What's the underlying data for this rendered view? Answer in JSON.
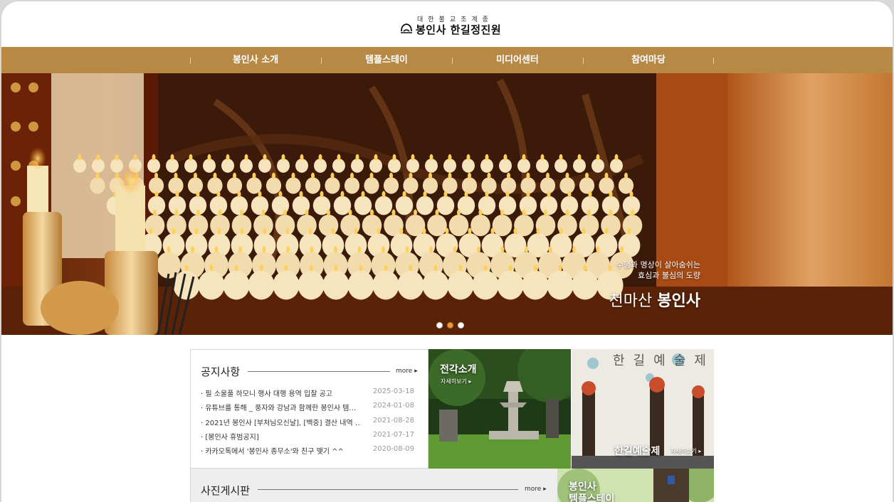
{
  "header": {
    "logo_subtitle": "대한불교조계종",
    "logo_name": "봉인사 한길정진원"
  },
  "nav": {
    "items": [
      "봉인사 소개",
      "템플스테이",
      "미디어센터",
      "참여마당"
    ]
  },
  "hero": {
    "line1": "수행과 명상이 살아숨쉬는",
    "line2": "효심과 불심의 도량",
    "title_prefix": "천마산 ",
    "title_bold": "봉인사",
    "slide_count": 3,
    "active_slide": 2
  },
  "notice": {
    "title": "공지사항",
    "more": "more",
    "rows": [
      {
        "title": "· 필 소울풀 하모니 행사 대행 용역 입찰 공고",
        "date": "2025-03-18"
      },
      {
        "title": "· 유튜브를 통해 _ 풍자와 강남과 함께한 봉인사 템…",
        "date": "2024-01-08"
      },
      {
        "title": "· 2021년 봉인사 [부처님오신날], [백중] 결산 내역 …",
        "date": "2021-08-28"
      },
      {
        "title": "· [봉인사 휴범공지]",
        "date": "2021-07-17"
      },
      {
        "title": "· 카카오톡에서 '봉인사 종무소'와 친구 맺기 ^^",
        "date": "2020-08-09"
      }
    ]
  },
  "cards": {
    "jeongak": {
      "title": "전각소개",
      "more": "자세히보기"
    },
    "festival": {
      "title": "한길예술제",
      "more": "자세히보기",
      "banner": "한길예술제"
    },
    "templestay": {
      "title_line1": "봉인사",
      "title_line2": "템플스테이"
    }
  },
  "photo_board": {
    "title": "사진게시판",
    "more": "more"
  },
  "colors": {
    "nav_bg": "#b88845",
    "active_dot": "#e79a33"
  }
}
